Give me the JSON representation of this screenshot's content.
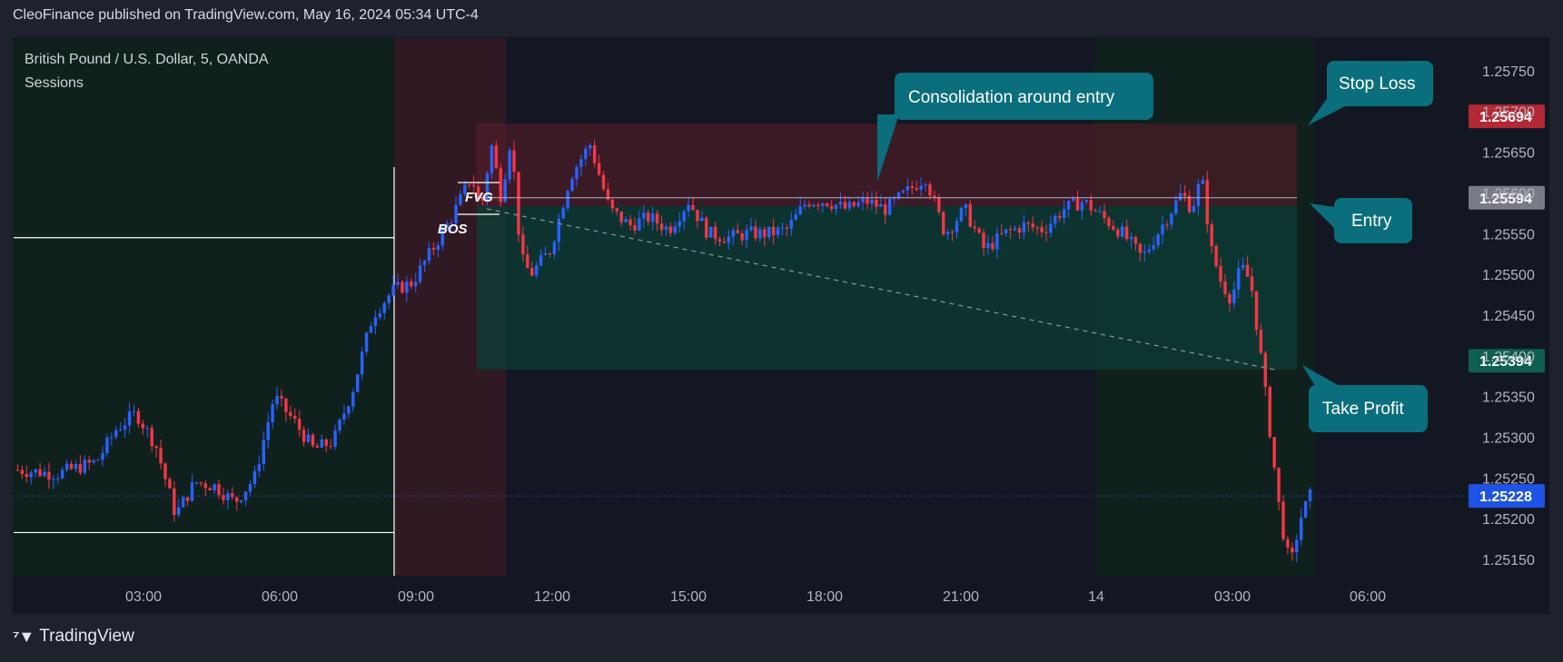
{
  "header": {
    "text": "CleoFinance published on TradingView.com, May 16, 2024 05:34 UTC-4"
  },
  "legend": {
    "symbol": "British Pound / U.S. Dollar, 5, OANDA",
    "indicator": "Sessions"
  },
  "footer": {
    "brand": "TradingView",
    "logo_icon": "tradingview-logo-icon"
  },
  "colors": {
    "up": "#2962ff",
    "down": "#f23645",
    "profit": "#089981",
    "loss": "#f23645",
    "callout": "#0b6e7c",
    "background": "#131722"
  },
  "annotations": {
    "consolidation": "Consolidation around entry",
    "stop_loss": "Stop Loss",
    "entry": "Entry",
    "take_profit": "Take Profit",
    "fvg": "FVG",
    "bos": "BOS"
  },
  "chart_data": {
    "type": "candlestick",
    "title": "British Pound / U.S. Dollar, 5, OANDA",
    "xlabel": "",
    "ylabel": "",
    "x_ticks": [
      "03:00",
      "06:00",
      "09:00",
      "12:00",
      "15:00",
      "18:00",
      "21:00",
      "14",
      "03:00",
      "06:00"
    ],
    "y_ticks": [
      1.2515,
      1.252,
      1.2525,
      1.253,
      1.2535,
      1.254,
      1.2545,
      1.255,
      1.2555,
      1.256,
      1.2565,
      1.257,
      1.2575
    ],
    "y_tick_labels": [
      "1.25150",
      "1.25200",
      "1.25250",
      "1.25300",
      "1.25350",
      "1.25400",
      "1.25450",
      "1.25500",
      "1.25550",
      "1.25600",
      "1.25650",
      "1.25700",
      "1.25750"
    ],
    "ylim": [
      1.2513,
      1.2579
    ],
    "price_levels": [
      {
        "name": "Stop Loss",
        "value": 1.25694,
        "label": "1.25694",
        "color": "#b22833"
      },
      {
        "name": "Entry",
        "value": 1.25594,
        "label": "1.25594",
        "color": "#787b86"
      },
      {
        "name": "Take Profit",
        "value": 1.25394,
        "label": "1.25394",
        "color": "#0f5f50"
      },
      {
        "name": "Last Price",
        "value": 1.25228,
        "label": "1.25228",
        "color": "#1e53e5"
      }
    ],
    "session_range_1": {
      "high": 1.25545,
      "low": 1.25183
    },
    "price_path": [
      [
        0,
        1.2526
      ],
      [
        4,
        1.25255
      ],
      [
        8,
        1.2527
      ],
      [
        10,
        1.2531
      ],
      [
        12,
        1.2533
      ],
      [
        14,
        1.2529
      ],
      [
        16,
        1.25205
      ],
      [
        18,
        1.25245
      ],
      [
        20,
        1.2524
      ],
      [
        22,
        1.2522
      ],
      [
        24,
        1.2525
      ],
      [
        26,
        1.2535
      ],
      [
        28,
        1.2532
      ],
      [
        30,
        1.25285
      ],
      [
        32,
        1.25295
      ],
      [
        34,
        1.2536
      ],
      [
        36,
        1.2545
      ],
      [
        38,
        1.2548
      ],
      [
        40,
        1.2549
      ],
      [
        42,
        1.2553
      ],
      [
        44,
        1.2557
      ],
      [
        46,
        1.2562
      ],
      [
        47,
        1.2558
      ],
      [
        48,
        1.2566
      ],
      [
        49,
        1.25595
      ],
      [
        50,
        1.2567
      ],
      [
        51,
        1.2552
      ],
      [
        52,
        1.255
      ],
      [
        54,
        1.2553
      ],
      [
        56,
        1.2562
      ],
      [
        58,
        1.2566
      ],
      [
        60,
        1.2558
      ],
      [
        62,
        1.2556
      ],
      [
        64,
        1.2557
      ],
      [
        66,
        1.25555
      ],
      [
        68,
        1.2559
      ],
      [
        70,
        1.2555
      ],
      [
        72,
        1.25545
      ],
      [
        74,
        1.2555
      ],
      [
        76,
        1.2555
      ],
      [
        78,
        1.25555
      ],
      [
        80,
        1.2559
      ],
      [
        82,
        1.2559
      ],
      [
        84,
        1.2558
      ],
      [
        86,
        1.2559
      ],
      [
        88,
        1.2558
      ],
      [
        90,
        1.256
      ],
      [
        92,
        1.2562
      ],
      [
        94,
        1.2555
      ],
      [
        96,
        1.2558
      ],
      [
        98,
        1.2553
      ],
      [
        100,
        1.2555
      ],
      [
        102,
        1.2556
      ],
      [
        104,
        1.25555
      ],
      [
        106,
        1.2558
      ],
      [
        108,
        1.2559
      ],
      [
        110,
        1.2557
      ],
      [
        112,
        1.2555
      ],
      [
        114,
        1.2552
      ],
      [
        116,
        1.2556
      ],
      [
        118,
        1.256
      ],
      [
        119,
        1.2558
      ],
      [
        120,
        1.2562
      ],
      [
        121,
        1.2553
      ],
      [
        122,
        1.2549
      ],
      [
        123,
        1.2547
      ],
      [
        124,
        1.2551
      ],
      [
        125,
        1.2549
      ],
      [
        126,
        1.254
      ],
      [
        127,
        1.253
      ],
      [
        128,
        1.252
      ],
      [
        129,
        1.2514
      ],
      [
        130,
        1.252
      ],
      [
        131,
        1.25228
      ]
    ]
  }
}
